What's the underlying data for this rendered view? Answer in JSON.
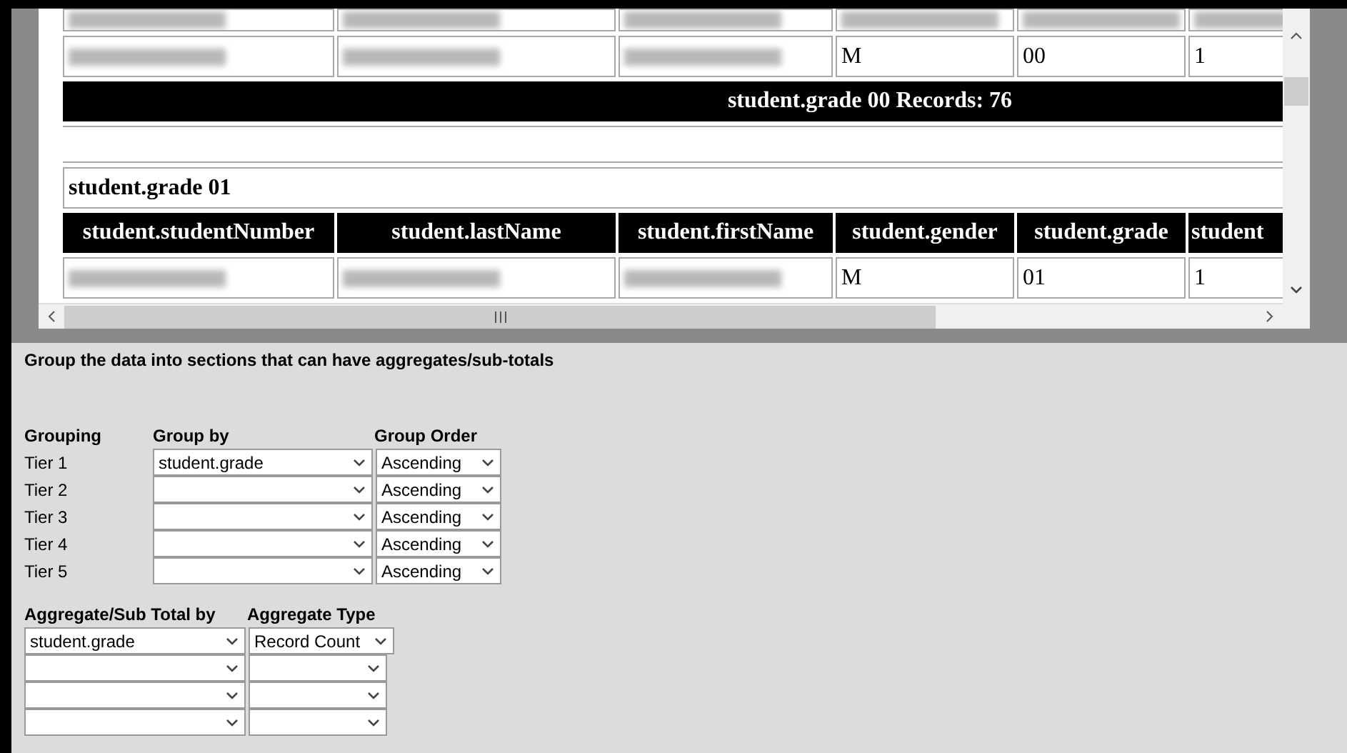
{
  "report_table": {
    "columns": [
      "student.studentNumber",
      "student.lastName",
      "student.firstName",
      "student.gender",
      "student.grade",
      "student"
    ],
    "groups": [
      {
        "rows": [
          {
            "cells": [
              {
                "kind": "redacted"
              },
              {
                "kind": "redacted"
              },
              {
                "kind": "redacted"
              },
              {
                "kind": "redacted"
              },
              {
                "kind": "redacted"
              },
              {
                "kind": "redacted"
              }
            ]
          },
          {
            "cells": [
              {
                "kind": "redacted"
              },
              {
                "kind": "redacted"
              },
              {
                "kind": "redacted"
              },
              {
                "kind": "text",
                "text": "M"
              },
              {
                "kind": "text",
                "text": "00"
              },
              {
                "kind": "text",
                "text": "1"
              }
            ]
          }
        ],
        "footer": "student.grade 00 Records: 76"
      },
      {
        "title": "student.grade 01",
        "rows": [
          {
            "cells": [
              {
                "kind": "redacted"
              },
              {
                "kind": "redacted"
              },
              {
                "kind": "redacted"
              },
              {
                "kind": "text",
                "text": "M"
              },
              {
                "kind": "text",
                "text": "01"
              },
              {
                "kind": "text",
                "text": "1"
              }
            ]
          }
        ]
      }
    ]
  },
  "description": "Group the data into sections that can have aggregates/sub-totals",
  "grouping": {
    "columns": [
      "Grouping",
      "Group by",
      "Group Order"
    ],
    "tiers": [
      {
        "label": "Tier 1",
        "group_by": "student.grade",
        "order": "Ascending"
      },
      {
        "label": "Tier 2",
        "order": "Ascending"
      },
      {
        "label": "Tier 3",
        "order": "Ascending"
      },
      {
        "label": "Tier 4",
        "order": "Ascending"
      },
      {
        "label": "Tier 5",
        "order": "Ascending"
      }
    ]
  },
  "aggregates": {
    "columns": [
      "Aggregate/Sub Total by",
      "Aggregate Type"
    ],
    "rows": [
      {
        "field": "student.grade",
        "type": "Record Count"
      },
      {},
      {},
      {}
    ]
  }
}
